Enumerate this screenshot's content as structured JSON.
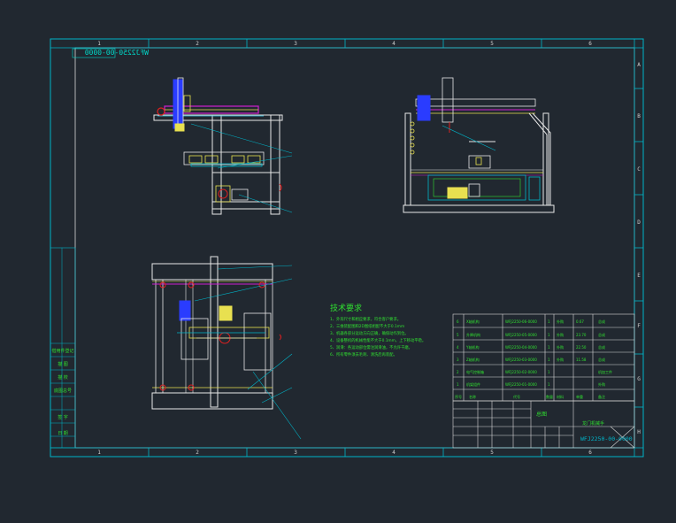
{
  "drawing_code": "WFJ2250-00-0000",
  "title_block_code": "WFJ2250-00-0000",
  "title_name": "龙门机械手",
  "title_mark": "总图",
  "tech_title": "技术要求",
  "tech_lines": [
    "1、外形尺寸和相应要求，符合客户要求。",
    "2、三维装配图和2D图纸相配不大于0.1mm",
    "3、机器各部分运动方向正确，确保动作到位。",
    "4、设备整机的机械性能不大于0.1mm，上下移动平稳。",
    "5、润滑：各运动部位需注润滑油，不允许干磨。",
    "6、所有零件须去毛刺、清洗后再装配。"
  ],
  "col_numbers": [
    "1",
    "2",
    "3",
    "4",
    "5",
    "6"
  ],
  "row_letters": [
    "A",
    "B",
    "C",
    "D",
    "E",
    "F",
    "G",
    "H"
  ],
  "bom_rows": [
    [
      "6",
      "X轴机构",
      "WFJ2250-06-0000",
      "1",
      "外购",
      "0.67",
      "总成"
    ],
    [
      "5",
      "升降机构",
      "WFJ2250-05-0000",
      "1",
      "外购",
      "23.70",
      "总成"
    ],
    [
      "4",
      "Y轴机构",
      "WFJ2250-04-0000",
      "1",
      "外购",
      "22.50",
      "总成"
    ],
    [
      "3",
      "Z轴机构",
      "WFJ2250-03-0000",
      "1",
      "外购",
      "11.58",
      "总成"
    ],
    [
      "2",
      "电气控制箱",
      "WFJ2250-02-0000",
      "1",
      "",
      "",
      "机加工件"
    ],
    [
      "1",
      "机架组件",
      "WFJ2250-01-0000",
      "1",
      "",
      "",
      "外购"
    ]
  ],
  "bom_header": [
    "序号",
    "代号",
    "名称",
    "数量",
    "材料",
    "单重",
    "备注"
  ],
  "left_strip": [
    "借用件登记",
    "描 图",
    "描 校",
    "底图总号",
    "签 字",
    "日 期"
  ],
  "colors": {
    "background": "#212830",
    "frame": "#00b4c8",
    "white": "#e8e8e8",
    "yellow": "#e8e050",
    "magenta": "#d020d0",
    "blue": "#2a3cff",
    "red": "#e02020",
    "green": "#20d040"
  }
}
